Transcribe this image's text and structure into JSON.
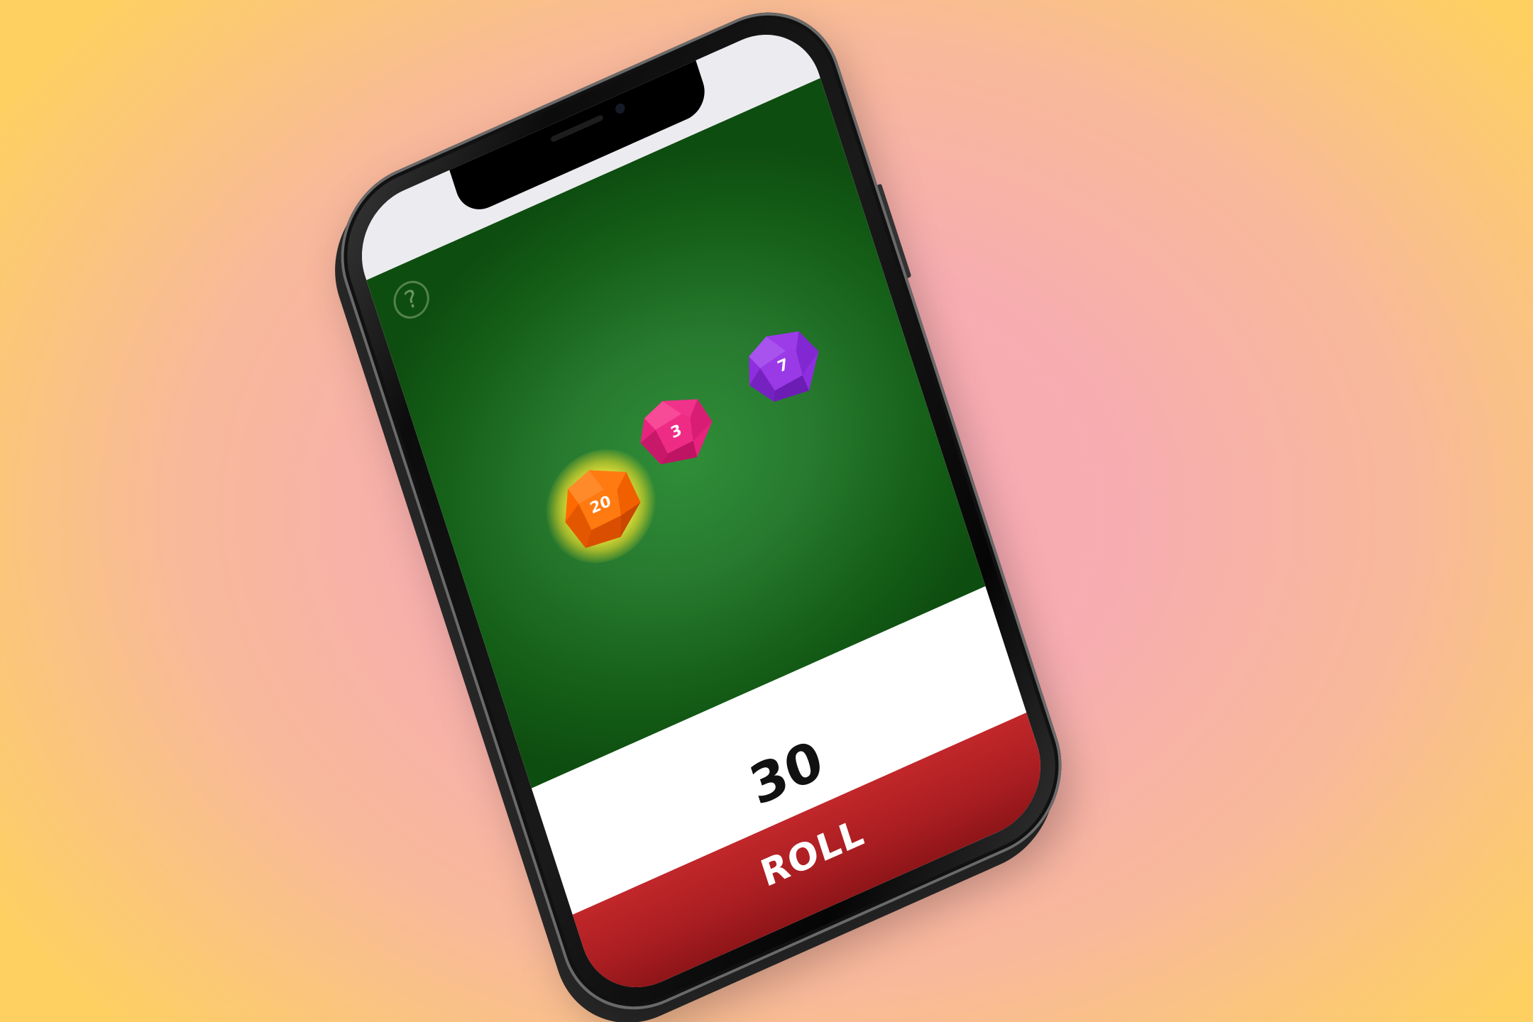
{
  "app": {
    "help_icon": "question-circle-icon",
    "help_glyph": "?",
    "dice": [
      {
        "label": "20",
        "color": "#ff6a00",
        "highlighted": true
      },
      {
        "label": "3",
        "color": "#e8237e",
        "highlighted": false
      },
      {
        "label": "7",
        "color": "#8f2ee0",
        "highlighted": false
      }
    ],
    "total": "30",
    "roll_label": "ROLL"
  },
  "colors": {
    "background_inner": "#f6a8b6",
    "background_outer": "#fed062",
    "table_green": "#2f8e38",
    "roll_red": "#b01f23"
  }
}
